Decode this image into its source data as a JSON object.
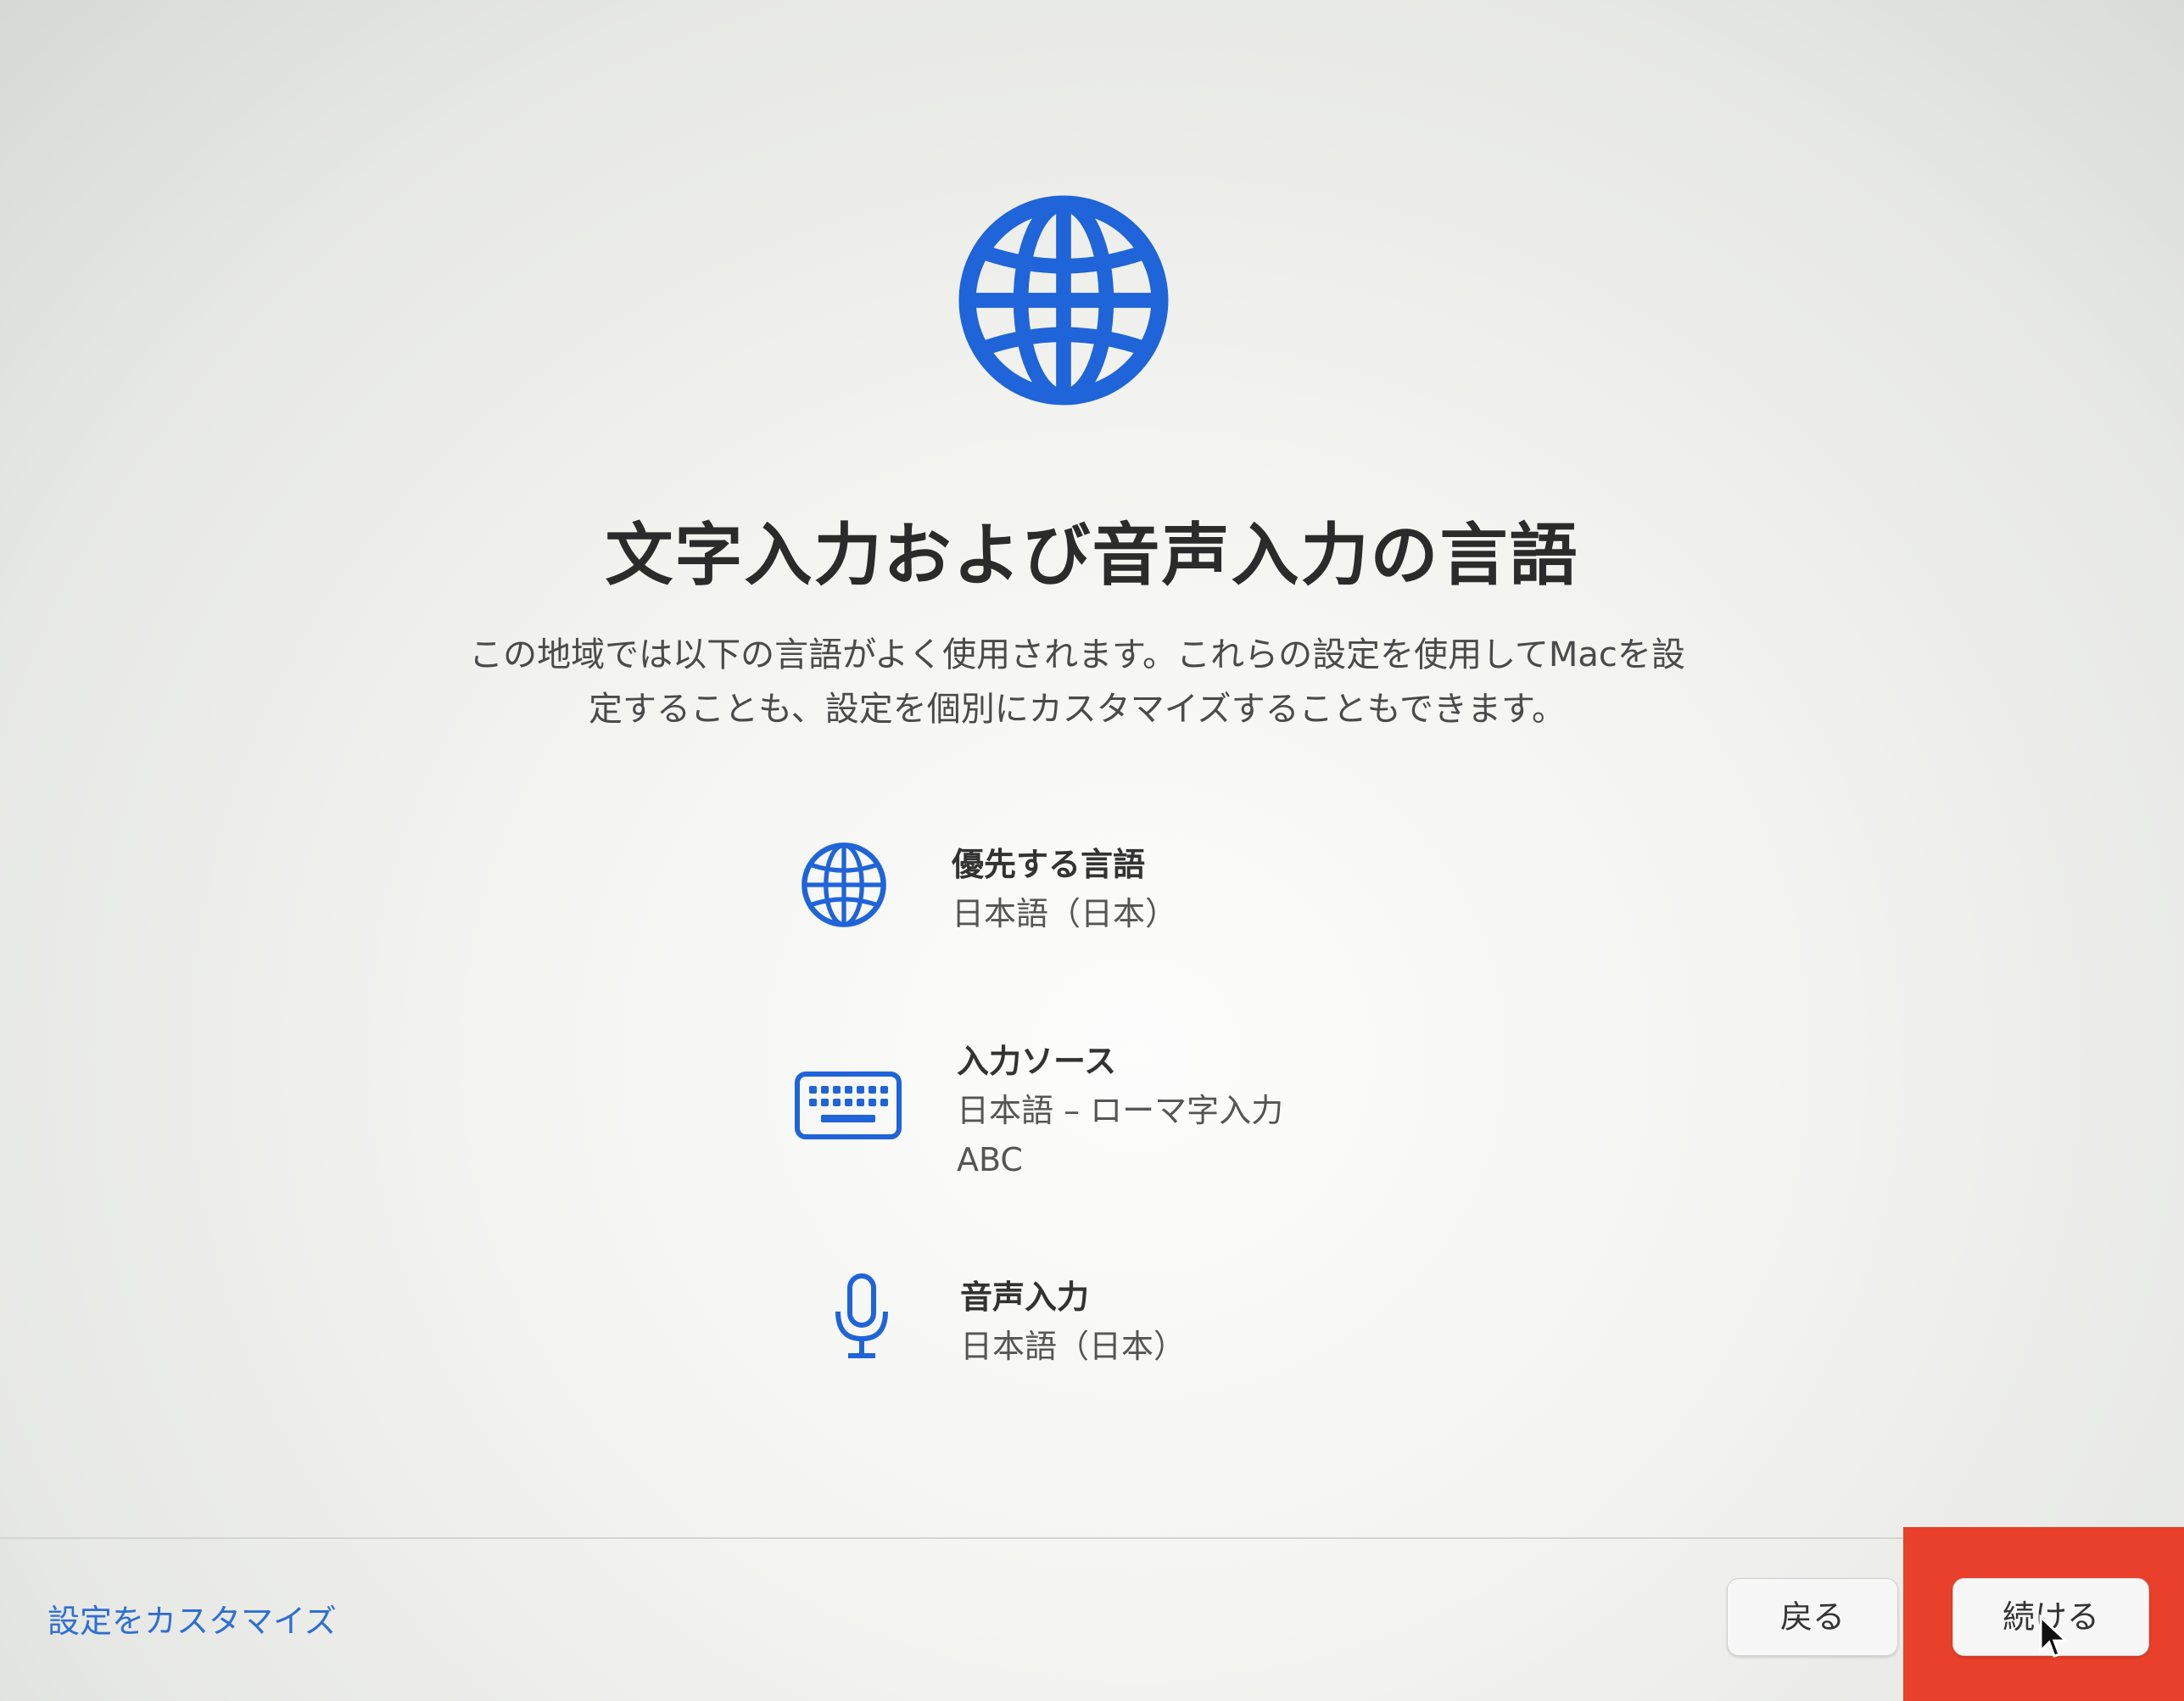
{
  "title": "文字入力および音声入力の言語",
  "description_line1": "この地域では以下の言語がよく使用されます。これらの設定を使用してMacを設",
  "description_line2": "定することも、設定を個別にカスタマイズすることもできます。",
  "settings": [
    {
      "icon": "globe-icon",
      "label": "優先する言語",
      "values": [
        "日本語（日本）"
      ]
    },
    {
      "icon": "keyboard-icon",
      "label": "入力ソース",
      "values": [
        "日本語 – ローマ字入力",
        "ABC"
      ]
    },
    {
      "icon": "microphone-icon",
      "label": "音声入力",
      "values": [
        "日本語（日本）"
      ]
    }
  ],
  "footer": {
    "customize_label": "設定をカスタマイズ",
    "back_label": "戻る",
    "continue_label": "続ける"
  },
  "colors": {
    "accent": "#2f6fd1",
    "icon_blue": "#1f64d8",
    "highlight": "#e8402a"
  }
}
